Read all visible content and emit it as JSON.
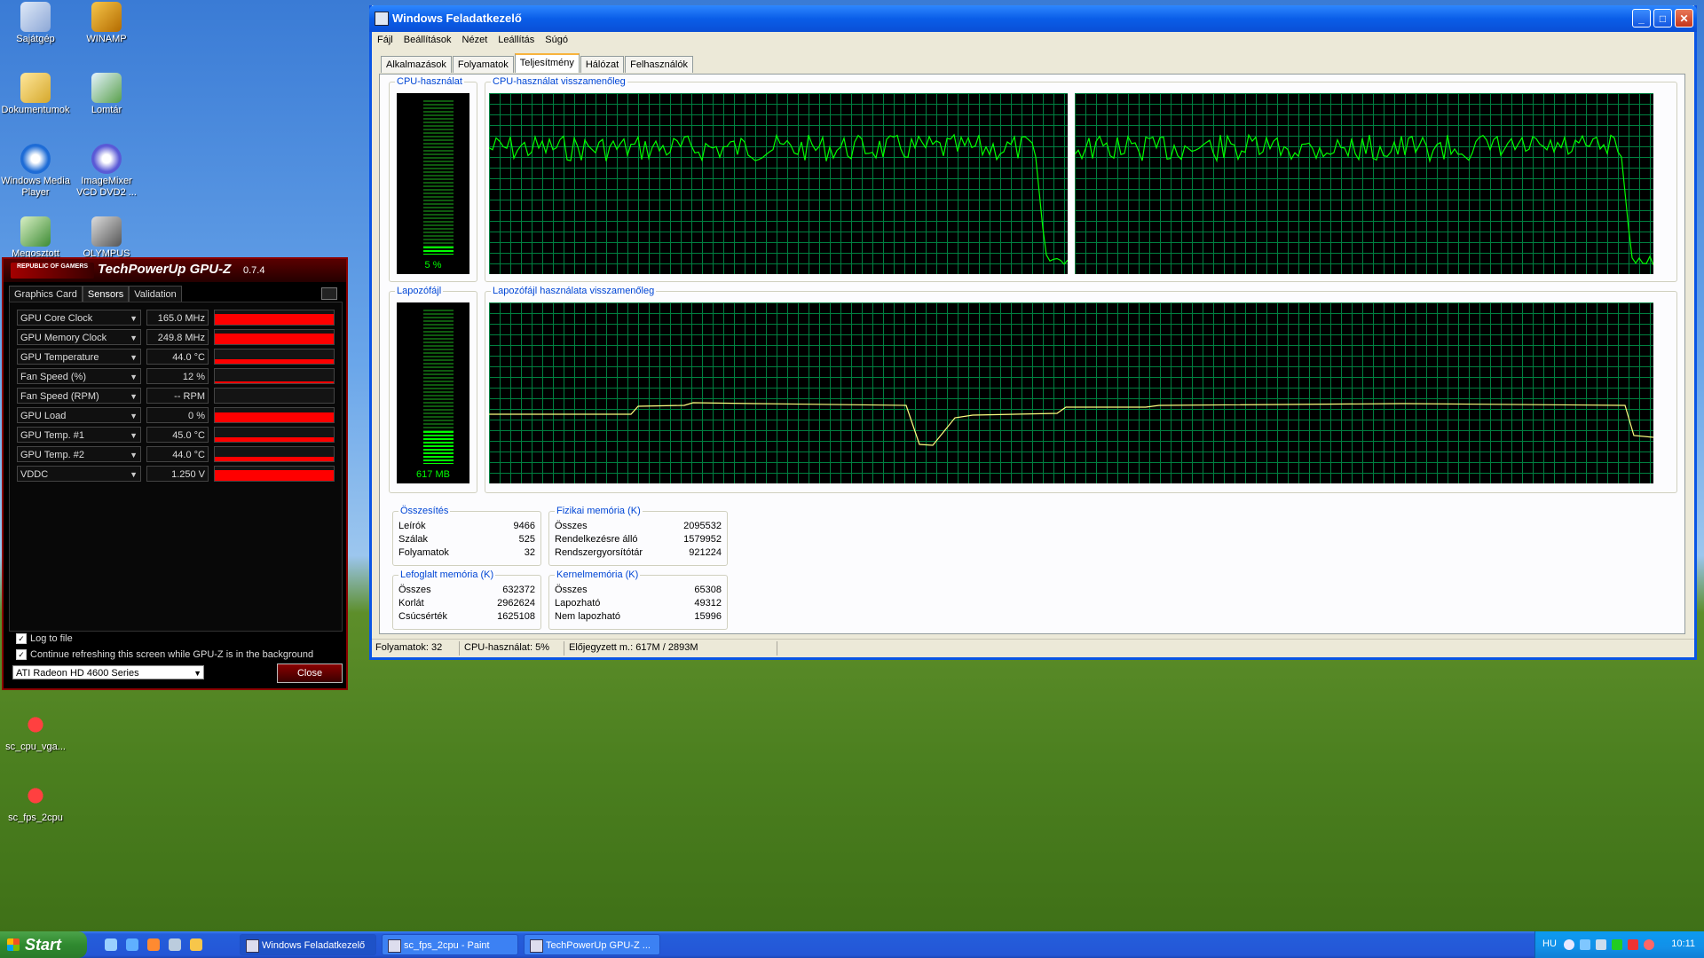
{
  "desktop": {
    "icons": [
      {
        "label": "Sajátgép"
      },
      {
        "label": "WINAMP"
      },
      {
        "label": "Dokumentumok"
      },
      {
        "label": "Lomtár"
      },
      {
        "label": "Windows Media Player"
      },
      {
        "label": "ImageMixer VCD DVD2 ..."
      },
      {
        "label": "Megosztott"
      },
      {
        "label": "OLYMPUS"
      },
      {
        "label": "sc_cpu_vga..."
      },
      {
        "label": "sc_fps_2cpu"
      }
    ]
  },
  "taskmgr": {
    "title": "Windows Feladatkezelő",
    "menu": [
      "Fájl",
      "Beállítások",
      "Nézet",
      "Leállítás",
      "Súgó"
    ],
    "tabs": [
      "Alkalmazások",
      "Folyamatok",
      "Teljesítmény",
      "Hálózat",
      "Felhasználók"
    ],
    "active_tab": "Teljesítmény",
    "cpu_usage": {
      "title": "CPU-használat",
      "value_text": "5 %",
      "level": 0.05
    },
    "cpu_history": {
      "title": "CPU-használat visszamenőleg"
    },
    "pagefile": {
      "title": "Lapozófájl",
      "value_text": "617 MB",
      "level": 0.21
    },
    "pagefile_history": {
      "title": "Lapozófájl használata visszamenőleg"
    },
    "totals": {
      "title": "Összesítés",
      "rows": [
        {
          "k": "Leírók",
          "v": "9466"
        },
        {
          "k": "Szálak",
          "v": "525"
        },
        {
          "k": "Folyamatok",
          "v": "32"
        }
      ]
    },
    "physical": {
      "title": "Fizikai memória (K)",
      "rows": [
        {
          "k": "Összes",
          "v": "2095532"
        },
        {
          "k": "Rendelkezésre álló",
          "v": "1579952"
        },
        {
          "k": "Rendszergyorsítótár",
          "v": "921224"
        }
      ]
    },
    "commit": {
      "title": "Lefoglalt memória (K)",
      "rows": [
        {
          "k": "Összes",
          "v": "632372"
        },
        {
          "k": "Korlát",
          "v": "2962624"
        },
        {
          "k": "Csúcsérték",
          "v": "1625108"
        }
      ]
    },
    "kernel": {
      "title": "Kernelmemória (K)",
      "rows": [
        {
          "k": "Összes",
          "v": "65308"
        },
        {
          "k": "Lapozható",
          "v": "49312"
        },
        {
          "k": "Nem lapozható",
          "v": "15996"
        }
      ]
    },
    "status": {
      "processes": "Folyamatok: 32",
      "cpu": "CPU-használat: 5%",
      "commit": "Előjegyzett m.: 617M / 2893M"
    }
  },
  "gpuz": {
    "logo": "REPUBLIC OF GAMERS",
    "title": "TechPowerUp GPU-Z",
    "version": "0.7.4",
    "tabs": [
      "Graphics Card",
      "Sensors",
      "Validation"
    ],
    "active_tab": "Sensors",
    "sensors": [
      {
        "name": "GPU Core Clock",
        "value": "165.0 MHz",
        "level": 0.78
      },
      {
        "name": "GPU Memory Clock",
        "value": "249.8 MHz",
        "level": 0.78
      },
      {
        "name": "GPU Temperature",
        "value": "44.0 °C",
        "level": 0.3
      },
      {
        "name": "Fan Speed (%)",
        "value": "12 %",
        "level": 0.12
      },
      {
        "name": "Fan Speed (RPM)",
        "value": "-- RPM",
        "level": 0.0
      },
      {
        "name": "GPU Load",
        "value": "0 %",
        "level": 0.7
      },
      {
        "name": "GPU Temp. #1",
        "value": "45.0 °C",
        "level": 0.3
      },
      {
        "name": "GPU Temp. #2",
        "value": "44.0 °C",
        "level": 0.3
      },
      {
        "name": "VDDC",
        "value": "1.250 V",
        "level": 0.78
      }
    ],
    "log_to_file": "Log to file",
    "continue_refresh": "Continue refreshing this screen while GPU-Z is in the background",
    "device": "ATI Radeon HD 4600 Series",
    "close_label": "Close"
  },
  "taskbar": {
    "start_label": "Start",
    "tasks": [
      "Windows Feladatkezelő",
      "sc_fps_2cpu - Paint",
      "TechPowerUp GPU-Z ..."
    ],
    "lang": "HU",
    "clock": "10:11"
  },
  "colors": {
    "graph_line": "#00ff00",
    "page_line": "#ffff80",
    "gpuz_bar": "#ff0000",
    "xp_blue": "#0a55e5"
  }
}
